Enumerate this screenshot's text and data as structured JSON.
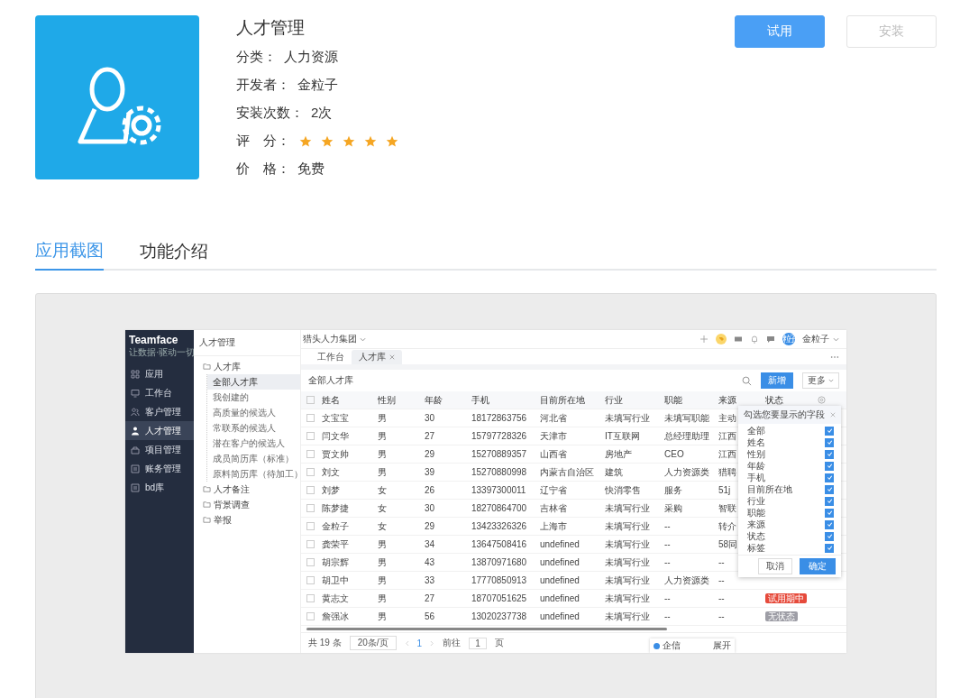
{
  "app": {
    "title": "人才管理",
    "fields": [
      {
        "label": "分类：",
        "value": "人力资源"
      },
      {
        "label": "开发者：",
        "value": "金粒子"
      },
      {
        "label": "安装次数：",
        "value": "2次"
      }
    ],
    "rating": {
      "label": "评　分：",
      "stars": 5
    },
    "price": {
      "label": "价　格：",
      "value": "免费"
    }
  },
  "buttons": [
    {
      "label": "试用",
      "disabled": false
    },
    {
      "label": "安装",
      "disabled": true
    }
  ],
  "tabs": [
    {
      "label": "应用截图",
      "selected": true
    },
    {
      "label": "功能介绍",
      "selected": false
    }
  ],
  "screenshot": {
    "brand": {
      "name": "Teamface",
      "slogan": "让数据·驱动一切"
    },
    "nav": [
      {
        "label": "应用",
        "selected": false
      },
      {
        "label": "工作台",
        "selected": false
      },
      {
        "label": "客户管理",
        "selected": false
      },
      {
        "label": "人才管理",
        "selected": true
      },
      {
        "label": "项目管理",
        "selected": false
      },
      {
        "label": "账务管理",
        "selected": false
      },
      {
        "label": "bd库",
        "selected": false
      }
    ],
    "org": "猎头人力集团",
    "user": {
      "avatar": "粒子",
      "name": "金粒子"
    },
    "module_title": "人才管理",
    "tree": [
      {
        "label": "人才库",
        "selected": false,
        "children": [
          {
            "label": "全部人才库",
            "selected": true
          },
          {
            "label": "我创建的",
            "selected": false
          },
          {
            "label": "高质量的候选人",
            "selected": false
          },
          {
            "label": "常联系的候选人",
            "selected": false
          },
          {
            "label": "潜在客户的候选人",
            "selected": false
          },
          {
            "label": "成员简历库（标准）",
            "selected": false
          },
          {
            "label": "原料简历库（待加工）",
            "selected": false
          }
        ]
      },
      {
        "label": "人才备注",
        "selected": false
      },
      {
        "label": "背景调查",
        "selected": false
      },
      {
        "label": "举报",
        "selected": false
      }
    ],
    "tabs": [
      {
        "label": "工作台",
        "selected": false,
        "closable": false
      },
      {
        "label": "人才库",
        "selected": true,
        "closable": true
      }
    ],
    "panel_title": "全部人才库",
    "add_button": "新增",
    "more_button": "更多",
    "table": {
      "all_checked": false,
      "columns": [
        "姓名",
        "性别",
        "年龄",
        "手机",
        "目前所在地",
        "行业",
        "职能",
        "来源",
        "状态"
      ],
      "rows": [
        {
          "checked": false,
          "cells": [
            "文宝宝",
            "男",
            "30",
            "18172863756",
            "河北省",
            "未填写行业",
            "未填写职能",
            "主动"
          ]
        },
        {
          "checked": false,
          "cells": [
            "闫文华",
            "男",
            "27",
            "15797728326",
            "天津市",
            "IT互联网",
            "总经理助理",
            "江西"
          ]
        },
        {
          "checked": false,
          "cells": [
            "贾文帅",
            "男",
            "29",
            "15270889357",
            "山西省",
            "房地产",
            "CEO",
            "江西"
          ]
        },
        {
          "checked": false,
          "cells": [
            "刘文",
            "男",
            "39",
            "15270880998",
            "内蒙古自治区",
            "建筑",
            "人力资源类",
            "猎聘"
          ]
        },
        {
          "checked": false,
          "cells": [
            "刘梦",
            "女",
            "26",
            "13397300011",
            "辽宁省",
            "快消零售",
            "服务",
            "51j"
          ]
        },
        {
          "checked": false,
          "cells": [
            "陈梦捷",
            "女",
            "30",
            "18270864700",
            "吉林省",
            "未填写行业",
            "采购",
            "智联"
          ]
        },
        {
          "checked": false,
          "cells": [
            "金粒子",
            "女",
            "29",
            "13423326326",
            "上海市",
            "未填写行业",
            "--",
            "转介"
          ]
        },
        {
          "checked": false,
          "cells": [
            "龚荣平",
            "男",
            "34",
            "13647508416",
            "undefined",
            "未填写行业",
            "--",
            "58同"
          ]
        },
        {
          "checked": false,
          "cells": [
            "胡宗辉",
            "男",
            "43",
            "13870971680",
            "undefined",
            "未填写行业",
            "--",
            "--"
          ]
        },
        {
          "checked": false,
          "cells": [
            "胡卫中",
            "男",
            "33",
            "17770850913",
            "undefined",
            "未填写行业",
            "人力资源类",
            "--"
          ]
        },
        {
          "checked": false,
          "cells": [
            "黄志文",
            "男",
            "27",
            "18707051625",
            "undefined",
            "未填写行业",
            "--",
            "--"
          ],
          "status": {
            "text": "试用期中",
            "color": "#e64a3b"
          }
        },
        {
          "checked": false,
          "cells": [
            "詹强冰",
            "男",
            "56",
            "13020237738",
            "undefined",
            "未填写行业",
            "--",
            "--"
          ],
          "status": {
            "text": "无状态",
            "color": "#9e9ea6"
          }
        }
      ]
    },
    "field_picker": {
      "title": "勾选您要显示的字段",
      "fields": [
        {
          "label": "全部",
          "checked": true
        },
        {
          "label": "姓名",
          "checked": true
        },
        {
          "label": "性别",
          "checked": true
        },
        {
          "label": "年龄",
          "checked": true
        },
        {
          "label": "手机",
          "checked": true
        },
        {
          "label": "目前所在地",
          "checked": true
        },
        {
          "label": "行业",
          "checked": true
        },
        {
          "label": "职能",
          "checked": true
        },
        {
          "label": "来源",
          "checked": true
        },
        {
          "label": "状态",
          "checked": true
        },
        {
          "label": "标签",
          "checked": true
        }
      ],
      "cancel": "取消",
      "confirm": "确定"
    },
    "pagination": {
      "total": "共 19 条",
      "page_size": "20条/页",
      "current": "1",
      "goto_label": "前往",
      "goto_value": "1",
      "page_unit": "页"
    },
    "chat": {
      "label": "企信",
      "toggle": "展开"
    }
  }
}
